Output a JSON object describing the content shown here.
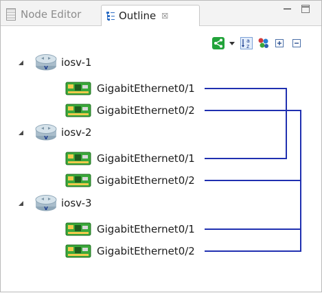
{
  "tabs": [
    {
      "label": "Node Editor",
      "icon": "node-editor-icon",
      "active": false
    },
    {
      "label": "Outline",
      "icon": "outline-icon",
      "active": true,
      "close": "☒"
    }
  ],
  "toolbar": {
    "icons": [
      "share-icon",
      "dropdown-arrow-icon",
      "sort-alphabetical-icon",
      "group-icon",
      "expand-all-icon",
      "collapse-all-icon"
    ]
  },
  "tree": {
    "nodes": [
      {
        "label": "iosv-1",
        "interfaces": [
          {
            "label": "GigabitEthernet0/1"
          },
          {
            "label": "GigabitEthernet0/2"
          }
        ]
      },
      {
        "label": "iosv-2",
        "interfaces": [
          {
            "label": "GigabitEthernet0/1"
          },
          {
            "label": "GigabitEthernet0/2"
          }
        ]
      },
      {
        "label": "iosv-3",
        "interfaces": [
          {
            "label": "GigabitEthernet0/1"
          },
          {
            "label": "GigabitEthernet0/2"
          }
        ]
      }
    ]
  },
  "colors": {
    "link": "#1f2fb0",
    "nic_green": "#3aa83a",
    "share_green": "#22a33a"
  }
}
